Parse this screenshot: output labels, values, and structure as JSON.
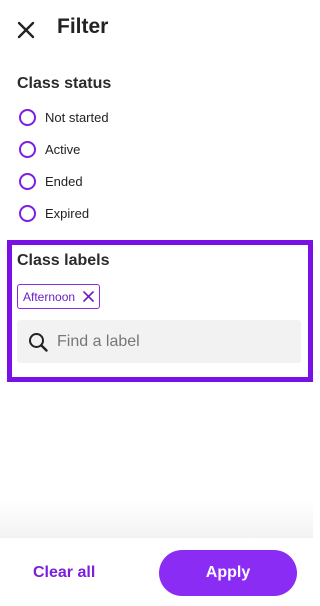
{
  "header": {
    "title": "Filter",
    "close_icon": "close-icon"
  },
  "class_status": {
    "title": "Class status",
    "options": [
      {
        "label": "Not started",
        "selected": false
      },
      {
        "label": "Active",
        "selected": false
      },
      {
        "label": "Ended",
        "selected": false
      },
      {
        "label": "Expired",
        "selected": false
      }
    ]
  },
  "class_labels": {
    "title": "Class labels",
    "selected_chips": [
      {
        "label": "Afternoon"
      }
    ],
    "search": {
      "placeholder": "Find a label",
      "value": "",
      "icon": "search-icon"
    }
  },
  "footer": {
    "clear_label": "Clear all",
    "apply_label": "Apply"
  },
  "colors": {
    "accent": "#8b2cf5",
    "highlight_border": "#7a10e8",
    "search_bg": "#f2f2f2"
  }
}
